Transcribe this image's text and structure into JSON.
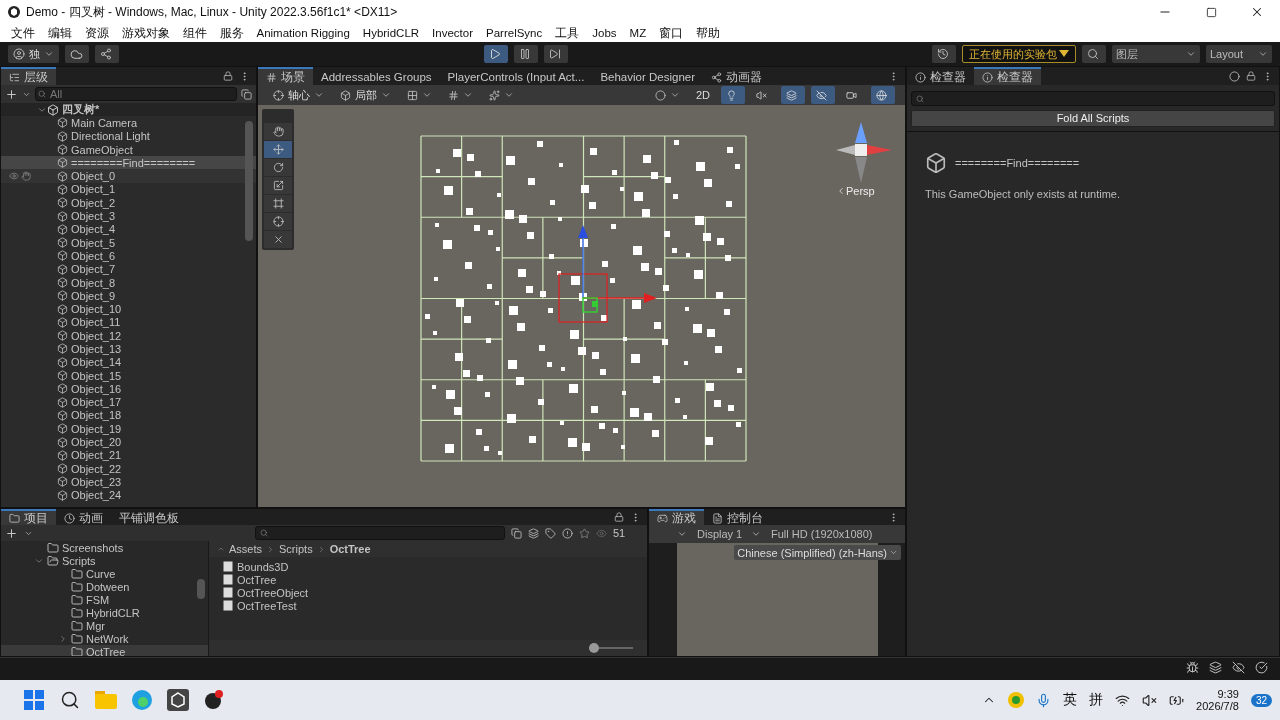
{
  "window": {
    "title": "Demo - 四叉树 - Windows, Mac, Linux - Unity 2022.3.56f1c1* <DX11>"
  },
  "menu": [
    "文件",
    "编辑",
    "资源",
    "游戏对象",
    "组件",
    "服务",
    "Animation Rigging",
    "HybridCLR",
    "Invector",
    "ParrelSync",
    "工具",
    "Jobs",
    "MZ",
    "窗口",
    "帮助"
  ],
  "toolbar": {
    "account": "独",
    "playing": true,
    "experimental": "正在使用的实验包",
    "layers": "图层",
    "layout": "Layout"
  },
  "hierarchy": {
    "title": "层级",
    "search_placeholder": "All",
    "root": {
      "name": "四叉树*",
      "expanded": true,
      "children": [
        {
          "name": "Main Camera",
          "selected": false,
          "hovered": false
        },
        {
          "name": "Directional Light",
          "selected": false,
          "hovered": false
        },
        {
          "name": "GameObject",
          "selected": false,
          "hovered": false
        },
        {
          "name": "========Find========",
          "selected": true,
          "hovered": false
        },
        {
          "name": "Object_0",
          "selected": false,
          "hovered": true
        },
        {
          "name": "Object_1",
          "selected": false,
          "hovered": false
        },
        {
          "name": "Object_2",
          "selected": false,
          "hovered": false
        },
        {
          "name": "Object_3",
          "selected": false,
          "hovered": false
        },
        {
          "name": "Object_4",
          "selected": false,
          "hovered": false
        },
        {
          "name": "Object_5",
          "selected": false,
          "hovered": false
        },
        {
          "name": "Object_6",
          "selected": false,
          "hovered": false
        },
        {
          "name": "Object_7",
          "selected": false,
          "hovered": false
        },
        {
          "name": "Object_8",
          "selected": false,
          "hovered": false
        },
        {
          "name": "Object_9",
          "selected": false,
          "hovered": false
        },
        {
          "name": "Object_10",
          "selected": false,
          "hovered": false
        },
        {
          "name": "Object_11",
          "selected": false,
          "hovered": false
        },
        {
          "name": "Object_12",
          "selected": false,
          "hovered": false
        },
        {
          "name": "Object_13",
          "selected": false,
          "hovered": false
        },
        {
          "name": "Object_14",
          "selected": false,
          "hovered": false
        },
        {
          "name": "Object_15",
          "selected": false,
          "hovered": false
        },
        {
          "name": "Object_16",
          "selected": false,
          "hovered": false
        },
        {
          "name": "Object_17",
          "selected": false,
          "hovered": false
        },
        {
          "name": "Object_18",
          "selected": false,
          "hovered": false
        },
        {
          "name": "Object_19",
          "selected": false,
          "hovered": false
        },
        {
          "name": "Object_20",
          "selected": false,
          "hovered": false
        },
        {
          "name": "Object_21",
          "selected": false,
          "hovered": false
        },
        {
          "name": "Object_22",
          "selected": false,
          "hovered": false
        },
        {
          "name": "Object_23",
          "selected": false,
          "hovered": false
        },
        {
          "name": "Object_24",
          "selected": false,
          "hovered": false
        }
      ]
    }
  },
  "scene": {
    "tabs": [
      {
        "label": "场景",
        "kind": "scene",
        "selected": true
      },
      {
        "label": "Addressables Groups",
        "kind": "plain",
        "selected": false
      },
      {
        "label": "PlayerControls (Input Act...",
        "kind": "plain",
        "selected": false
      },
      {
        "label": "Behavior Designer",
        "kind": "plain",
        "selected": false
      },
      {
        "label": "动画器",
        "kind": "animator",
        "selected": false
      }
    ],
    "pivot": "轴心",
    "space": "局部",
    "mode_2d": "2D",
    "projection": "Persp",
    "toggles": [
      {
        "kind": "lighting",
        "on": true
      },
      {
        "kind": "audio",
        "on": false
      },
      {
        "kind": "effects",
        "on": true
      },
      {
        "kind": "visibility",
        "on": true
      },
      {
        "kind": "camera",
        "on": false
      },
      {
        "kind": "gizmos",
        "on": true
      }
    ],
    "tools": [
      {
        "kind": "view",
        "selected": false
      },
      {
        "kind": "move",
        "selected": true
      },
      {
        "kind": "rotate",
        "selected": false
      },
      {
        "kind": "scale",
        "selected": false
      },
      {
        "kind": "rect",
        "selected": false
      },
      {
        "kind": "transform",
        "selected": false
      },
      {
        "kind": "custom",
        "selected": false
      }
    ]
  },
  "inspector": {
    "tabs": [
      {
        "label": "检查器",
        "selected": false
      },
      {
        "label": "检查器",
        "selected": true
      }
    ],
    "fold_button": "Fold All Scripts",
    "object_name": "========Find========",
    "message": "This GameObject only exists at runtime."
  },
  "project": {
    "tabs": [
      {
        "label": "项目",
        "kind": "project",
        "selected": true
      },
      {
        "label": "动画",
        "kind": "animation",
        "selected": false
      },
      {
        "label": "平铺调色板",
        "kind": "plain",
        "selected": false
      }
    ],
    "count": "51",
    "tree": [
      {
        "name": "Screenshots",
        "selected": false
      },
      {
        "name": "Scripts",
        "selected": false,
        "expanded": true,
        "children": [
          {
            "name": "Curve",
            "selected": false
          },
          {
            "name": "Dotween",
            "selected": false
          },
          {
            "name": "FSM",
            "selected": false
          },
          {
            "name": "HybridCLR",
            "selected": false
          },
          {
            "name": "Mgr",
            "selected": false
          },
          {
            "name": "NetWork",
            "selected": false,
            "expanded": false
          },
          {
            "name": "OctTree",
            "selected": true
          }
        ]
      }
    ],
    "breadcrumb": [
      "Assets",
      "Scripts",
      "OctTree"
    ],
    "files": [
      "Bounds3D",
      "OctTree",
      "OctTreeObject",
      "OctTreeTest"
    ],
    "zoom": {
      "level": 0
    }
  },
  "game": {
    "tabs": [
      {
        "label": "游戏",
        "kind": "game",
        "selected": true
      },
      {
        "label": "控制台",
        "kind": "console",
        "selected": false
      }
    ],
    "display": "Display 1",
    "resolution": "Full HD (1920x1080)",
    "language": "Chinese (Simplified) (zh-Hans)"
  },
  "taskbar": {
    "apps": [
      {
        "kind": "start"
      },
      {
        "kind": "search"
      },
      {
        "kind": "files"
      },
      {
        "kind": "browser"
      },
      {
        "kind": "unity"
      },
      {
        "kind": "app"
      }
    ],
    "ime_language": "英",
    "ime_mode": "拼",
    "time": "9:39",
    "date": "2026/7/8",
    "notifications": "32"
  }
}
